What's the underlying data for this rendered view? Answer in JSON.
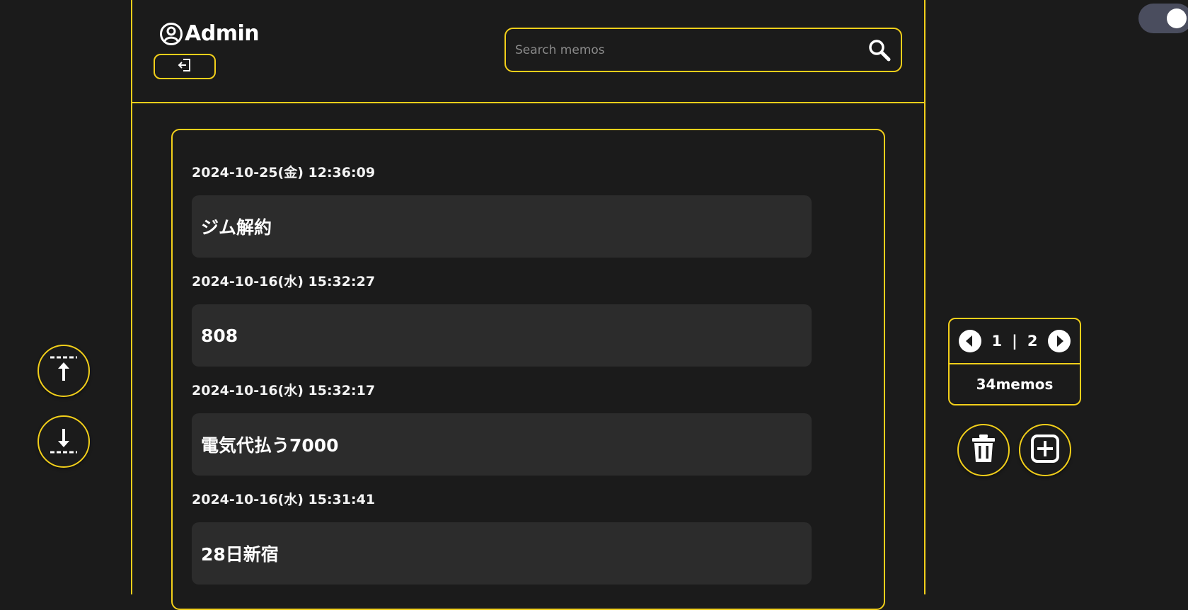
{
  "header": {
    "user_name": "Admin",
    "search_placeholder": "Search memos"
  },
  "memos": [
    {
      "date": "2024-10-25(金) 12:36:09",
      "text": "ジム解約"
    },
    {
      "date": "2024-10-16(水) 15:32:27",
      "text": "808"
    },
    {
      "date": "2024-10-16(水) 15:32:17",
      "text": "電気代払う7000"
    },
    {
      "date": "2024-10-16(水) 15:31:41",
      "text": "28日新宿"
    }
  ],
  "pager": {
    "current": "1",
    "separator": "|",
    "total": "2",
    "count_label": "34memos"
  },
  "icons": {
    "user": "user-circle-icon",
    "logout": "logout-icon",
    "search": "search-icon",
    "scroll_top": "scroll-top-icon",
    "scroll_bottom": "scroll-bottom-icon",
    "prev": "chevron-left-circle-icon",
    "next": "chevron-right-circle-icon",
    "delete": "trash-icon",
    "add": "add-square-icon"
  },
  "theme": {
    "accent": "#f2cf1a",
    "background": "#1b1b1b",
    "memo_background": "#2c2c2c",
    "toggle_track": "#4a4d5e"
  },
  "theme_toggle": {
    "on": true
  }
}
